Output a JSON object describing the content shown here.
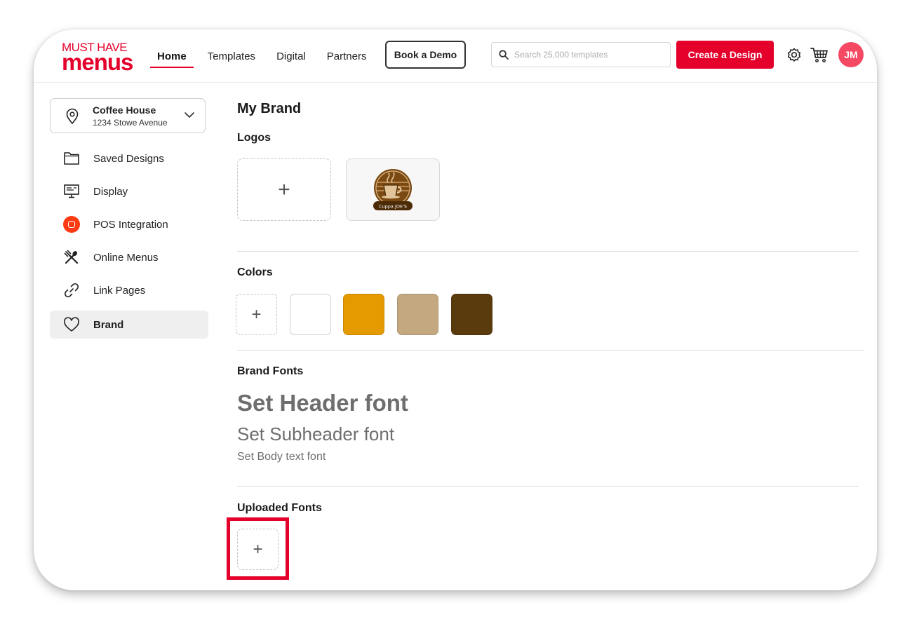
{
  "brand": {
    "logo_top": "MUST HAVE",
    "logo_bottom": "menus",
    "accent": "#e4002b"
  },
  "nav": {
    "items": [
      {
        "label": "Home",
        "active": true
      },
      {
        "label": "Templates"
      },
      {
        "label": "Digital"
      },
      {
        "label": "Partners"
      }
    ],
    "book_demo": "Book a Demo",
    "search_placeholder": "Search 25,000 templates",
    "create_button": "Create a Design",
    "avatar_initials": "JM",
    "avatar_color": "#f54963"
  },
  "location": {
    "name": "Coffee House",
    "address": "1234 Stowe Avenue"
  },
  "sidebar": {
    "items": [
      {
        "label": "Saved Designs",
        "icon": "folder-icon"
      },
      {
        "label": "Display",
        "icon": "monitor-icon"
      },
      {
        "label": "POS Integration",
        "icon": "pos-icon"
      },
      {
        "label": "Online Menus",
        "icon": "utensils-icon"
      },
      {
        "label": "Link Pages",
        "icon": "link-icon"
      },
      {
        "label": "Brand",
        "icon": "heart-icon",
        "active": true
      }
    ]
  },
  "main": {
    "title": "My Brand",
    "logos_heading": "Logos",
    "logo_text": "Cuppa JOE'S",
    "colors_heading": "Colors",
    "colors": [
      "#ffffff",
      "#e59a00",
      "#c4a980",
      "#5a3b0d"
    ],
    "fonts_heading": "Brand Fonts",
    "header_font": "Set Header font",
    "subheader_font": "Set Subheader font",
    "body_font": "Set Body text font",
    "uploaded_heading": "Uploaded Fonts"
  }
}
